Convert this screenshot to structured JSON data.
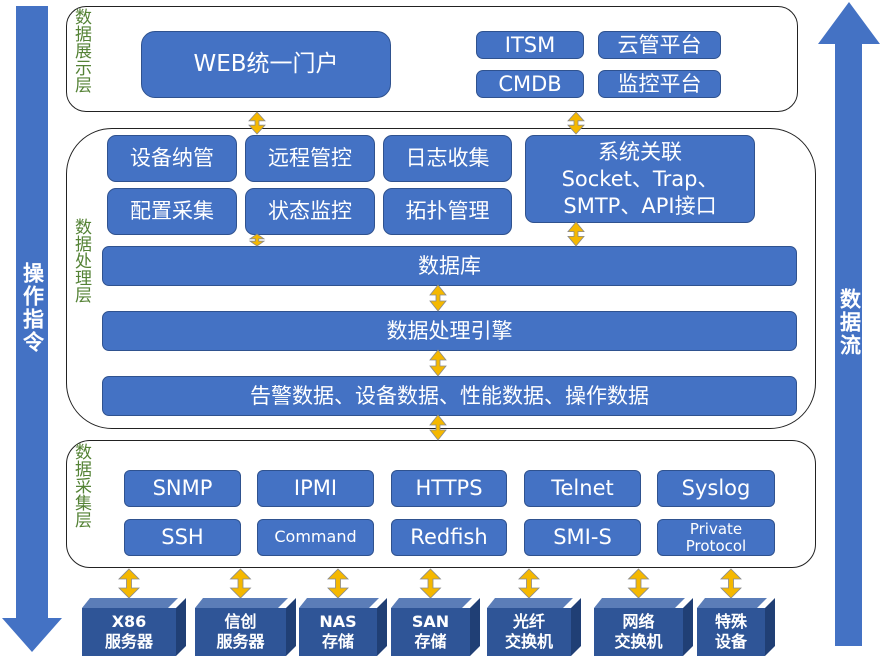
{
  "side_arrows": {
    "left": "操作指令",
    "right": "数据流",
    "color": "#4472C4"
  },
  "layers": {
    "display": {
      "label": "数据展示层",
      "web": "WEB统一门户",
      "itsm": "ITSM",
      "cloud": "云管平台",
      "cmdb": "CMDB",
      "monitor": "监控平台"
    },
    "processing": {
      "label": "数据处理层",
      "items": [
        "设备纳管",
        "远程管控",
        "日志收集",
        "配置采集",
        "状态监控",
        "拓扑管理"
      ],
      "system": [
        "系统关联",
        "Socket、Trap、",
        "SMTP、API接口"
      ],
      "database": "数据库",
      "engine": "数据处理引擎",
      "data": "告警数据、设备数据、性能数据、操作数据"
    },
    "collection": {
      "label": "数据采集层",
      "row1": [
        "SNMP",
        "IPMI",
        "HTTPS",
        "Telnet",
        "Syslog"
      ],
      "row2": [
        "SSH",
        "Command",
        "Redfish",
        "SMI-S",
        "Private Protocol"
      ]
    }
  },
  "devices": [
    [
      "X86",
      "服务器"
    ],
    [
      "信创",
      "服务器"
    ],
    [
      "NAS",
      "存储"
    ],
    [
      "SAN",
      "存储"
    ],
    [
      "光纤",
      "交换机"
    ],
    [
      "网络",
      "交换机"
    ],
    [
      "特殊",
      "设备"
    ]
  ],
  "colors": {
    "box": "#4472C4",
    "arrow": "#F5B800",
    "label": "#548235",
    "device": "#2F5597"
  }
}
